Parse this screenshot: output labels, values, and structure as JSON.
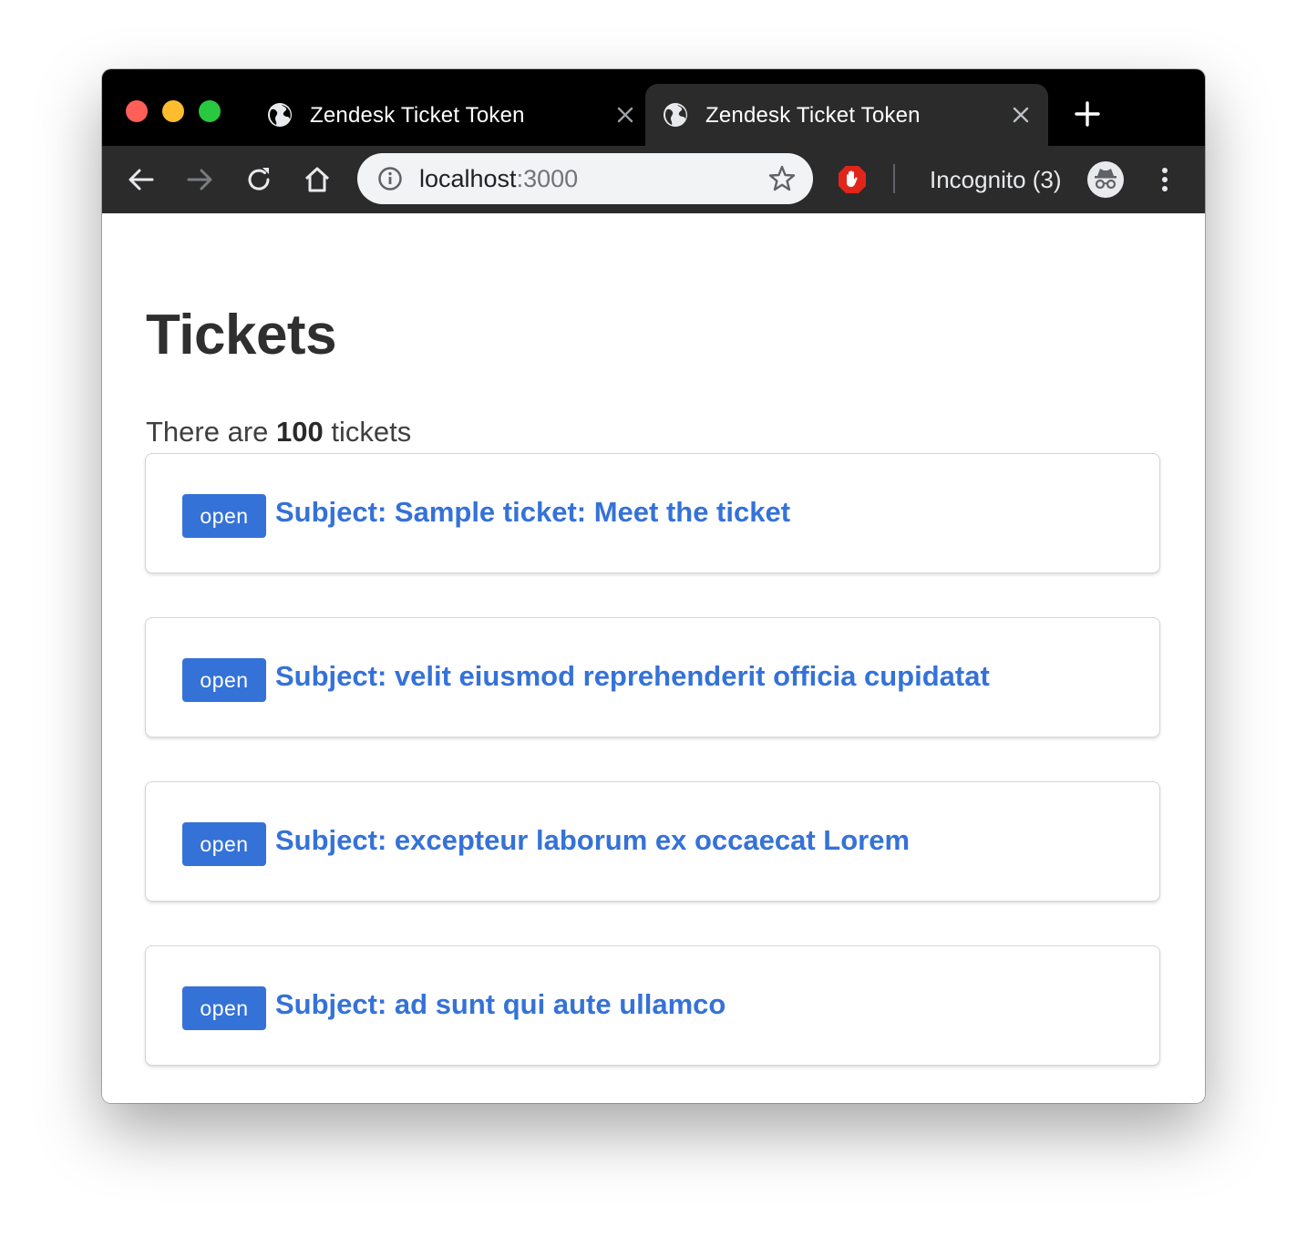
{
  "browser": {
    "tabs": [
      {
        "title": "Zendesk Ticket Token",
        "active": false
      },
      {
        "title": "Zendesk Ticket Token",
        "active": true
      }
    ],
    "address": {
      "host": "localhost",
      "port": ":3000"
    },
    "incognito_label": "Incognito (3)",
    "icons": [
      "globe-icon",
      "close-icon",
      "plus-icon",
      "back-icon",
      "forward-icon",
      "reload-icon",
      "home-icon",
      "info-icon",
      "star-icon",
      "adblock-icon",
      "incognito-icon",
      "kebab-menu-icon"
    ]
  },
  "page": {
    "title": "Tickets",
    "count_prefix": "There are",
    "count_value": "100",
    "count_suffix": "tickets",
    "tickets": [
      {
        "status": "open",
        "subject": "Subject: Sample ticket: Meet the ticket"
      },
      {
        "status": "open",
        "subject": "Subject: velit eiusmod reprehenderit officia cupidatat"
      },
      {
        "status": "open",
        "subject": "Subject: excepteur laborum ex occaecat Lorem"
      },
      {
        "status": "open",
        "subject": "Subject: ad sunt qui aute ullamco"
      }
    ]
  },
  "colors": {
    "link": "#3572d8",
    "badge": "#3572d8",
    "tabstrip": "#000000",
    "toolbar": "#2b2b2b"
  }
}
